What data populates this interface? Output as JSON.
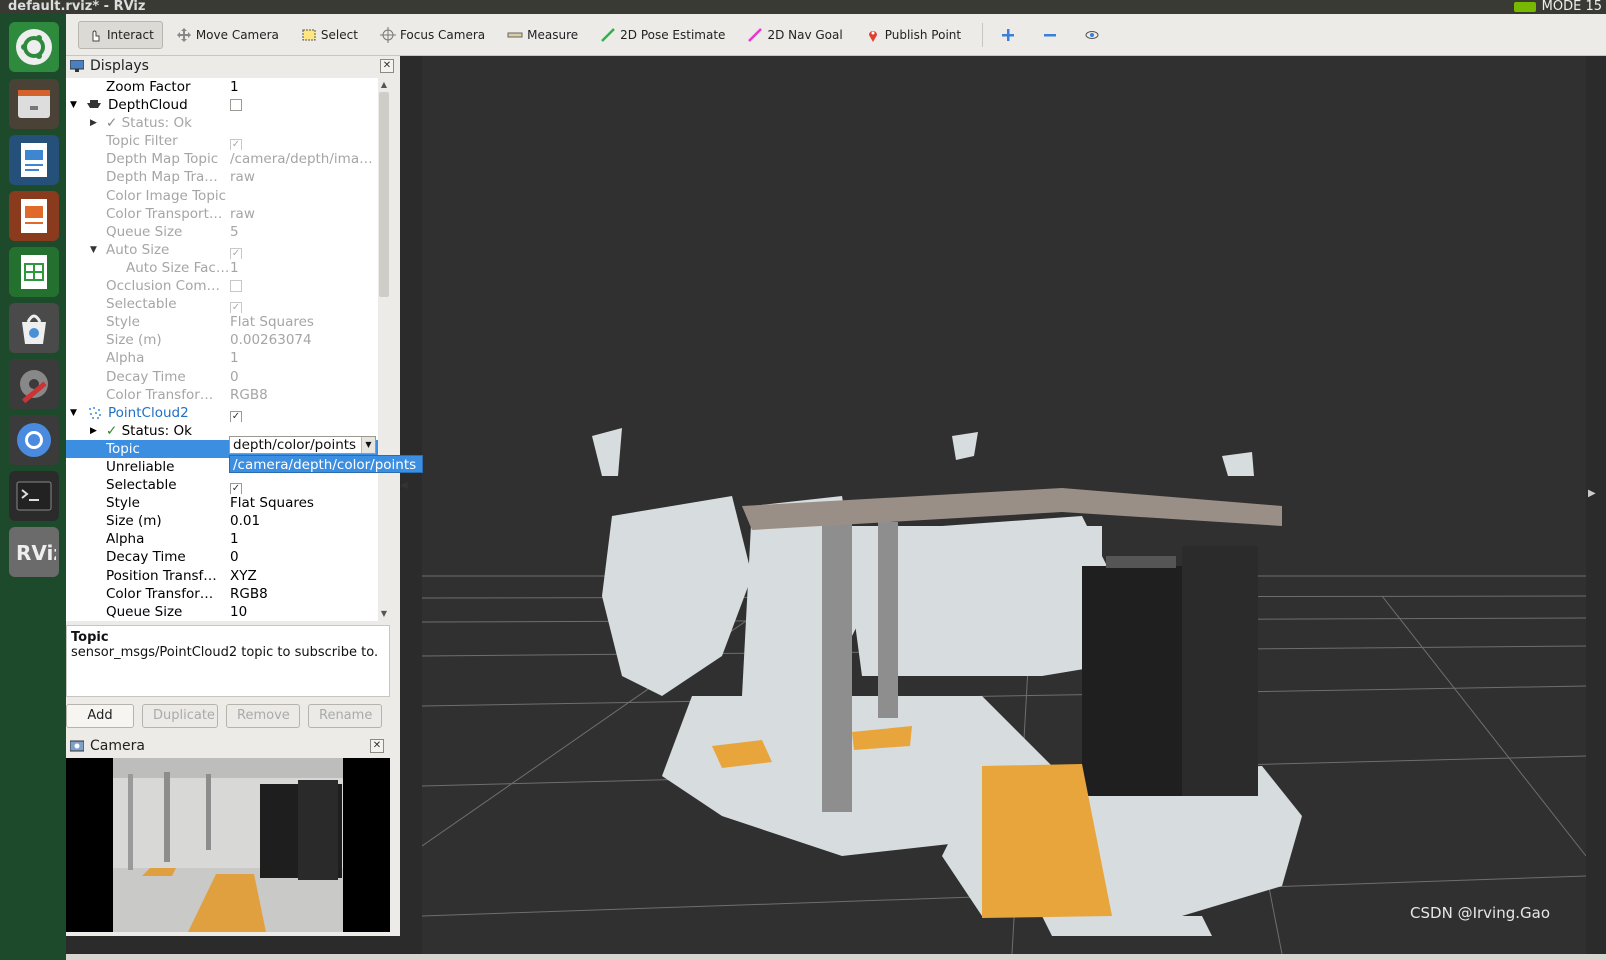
{
  "window": {
    "title": "default.rviz* - RViz",
    "mode_text": "MODE 15"
  },
  "launcher": {
    "items": [
      "ubuntu-icon",
      "files-icon",
      "writer-icon",
      "impress-icon",
      "calc-icon",
      "software-center-icon",
      "settings-icon",
      "chromium-icon",
      "terminal-icon",
      "rviz-icon"
    ]
  },
  "toolbar": {
    "interact": "Interact",
    "move_camera": "Move Camera",
    "select": "Select",
    "focus_camera": "Focus Camera",
    "measure": "Measure",
    "pose_estimate": "2D Pose Estimate",
    "nav_goal": "2D Nav Goal",
    "publish_point": "Publish Point"
  },
  "displays": {
    "title": "Displays",
    "rows": [
      {
        "name": "Zoom Factor",
        "value": "1"
      },
      {
        "name": "DepthCloud"
      },
      {
        "name": "Status: Ok"
      },
      {
        "name": "Topic Filter"
      },
      {
        "name": "Depth Map Topic",
        "value": "/camera/depth/ima…"
      },
      {
        "name": "Depth Map Tra…",
        "value": "raw"
      },
      {
        "name": "Color Image Topic",
        "value": ""
      },
      {
        "name": "Color Transport…",
        "value": "raw"
      },
      {
        "name": "Queue Size",
        "value": "5"
      },
      {
        "name": "Auto Size"
      },
      {
        "name": "Auto Size Fac…",
        "value": "1"
      },
      {
        "name": "Occlusion Com…"
      },
      {
        "name": "Selectable"
      },
      {
        "name": "Style",
        "value": "Flat Squares"
      },
      {
        "name": "Size (m)",
        "value": "0.00263074"
      },
      {
        "name": "Alpha",
        "value": "1"
      },
      {
        "name": "Decay Time",
        "value": "0"
      },
      {
        "name": "Color Transfor…",
        "value": "RGB8"
      },
      {
        "name": "PointCloud2"
      },
      {
        "name": "Status: Ok"
      },
      {
        "name": "Topic",
        "value": "depth/color/points"
      },
      {
        "name": "Unreliable"
      },
      {
        "name": "Selectable"
      },
      {
        "name": "Style",
        "value": "Flat Squares"
      },
      {
        "name": "Size (m)",
        "value": "0.01"
      },
      {
        "name": "Alpha",
        "value": "1"
      },
      {
        "name": "Decay Time",
        "value": "0"
      },
      {
        "name": "Position Transf…",
        "value": "XYZ"
      },
      {
        "name": "Color Transfor…",
        "value": "RGB8"
      },
      {
        "name": "Queue Size",
        "value": "10"
      }
    ],
    "checkmark": "✓",
    "dropdown_option": "/camera/depth/color/points"
  },
  "description": {
    "title": "Topic",
    "text": "sensor_msgs/PointCloud2 topic to subscribe to."
  },
  "buttons": {
    "add": "Add",
    "duplicate": "Duplicate",
    "remove": "Remove",
    "rename": "Rename"
  },
  "camera": {
    "title": "Camera"
  },
  "viewport": {
    "watermark": "CSDN @Irving.Gao"
  },
  "colors": {
    "accent": "#3b8ee0",
    "floor_tile": "#e8a53c",
    "background": "#303030"
  }
}
